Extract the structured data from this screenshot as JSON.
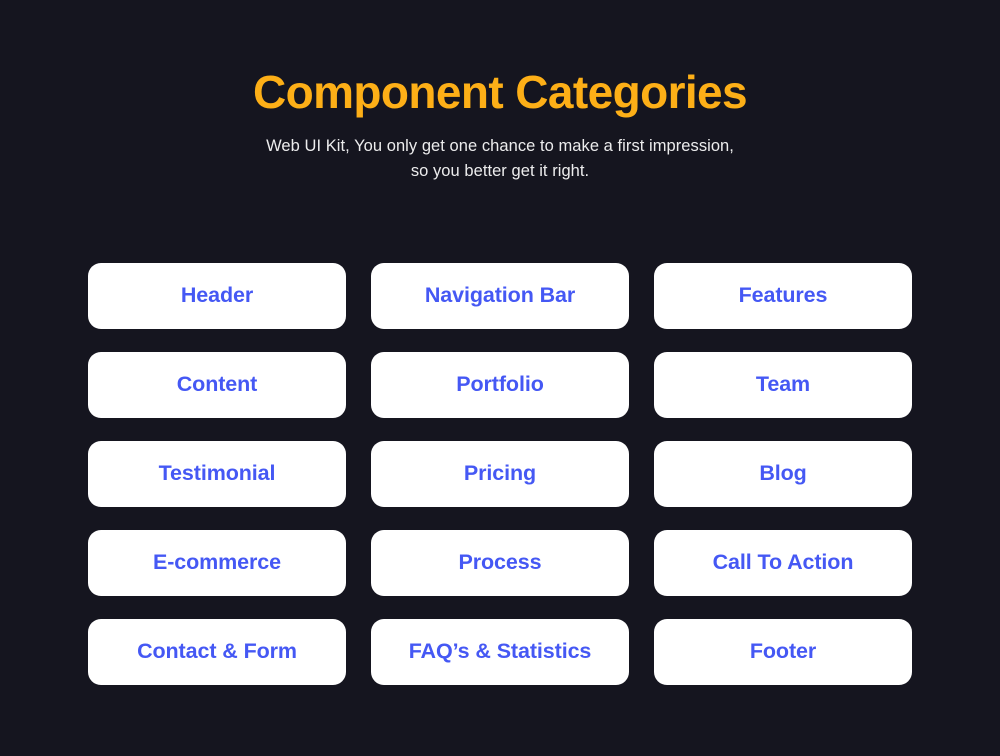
{
  "theme": {
    "background": "#15151f",
    "card_background": "#ffffff",
    "title_color": "#FDAF17",
    "subtitle_color": "#ececed",
    "label_color": "#4558F4"
  },
  "header": {
    "title": "Component Categories",
    "subtitle_line_1": "Web UI Kit, You only get one chance to make a first impression,",
    "subtitle_line_2": "so you better get it right."
  },
  "categories": [
    {
      "label": "Header"
    },
    {
      "label": "Navigation Bar"
    },
    {
      "label": "Features"
    },
    {
      "label": "Content"
    },
    {
      "label": "Portfolio"
    },
    {
      "label": "Team"
    },
    {
      "label": "Testimonial"
    },
    {
      "label": "Pricing"
    },
    {
      "label": "Blog"
    },
    {
      "label": "E-commerce"
    },
    {
      "label": "Process"
    },
    {
      "label": "Call To Action"
    },
    {
      "label": "Contact & Form"
    },
    {
      "label": "FAQ’s & Statistics"
    },
    {
      "label": "Footer"
    }
  ]
}
